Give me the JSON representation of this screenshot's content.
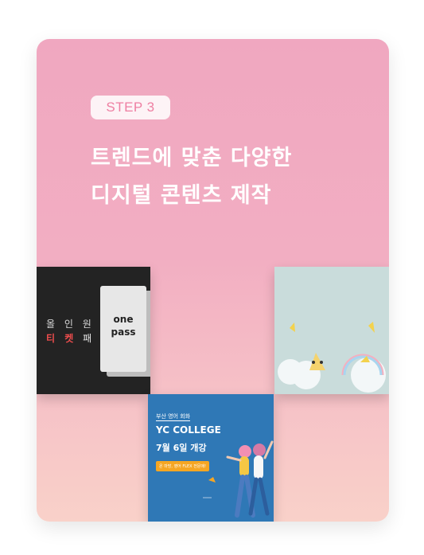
{
  "badge": "STEP 3",
  "title": {
    "line1": "트렌드에 맞춘 다양한",
    "line2": "디지털 콘텐츠 제작"
  },
  "thumb1": {
    "line1": "올 인 원",
    "red": "티 켓",
    "white": "패 스",
    "ticket": "one pass"
  },
  "thumb3": {
    "small": "부산 영어 회화",
    "title": "YC COLLEGE",
    "date": "7월 6일 개강",
    "tag": "온 마망, 영어 FLEX 전문매!"
  }
}
